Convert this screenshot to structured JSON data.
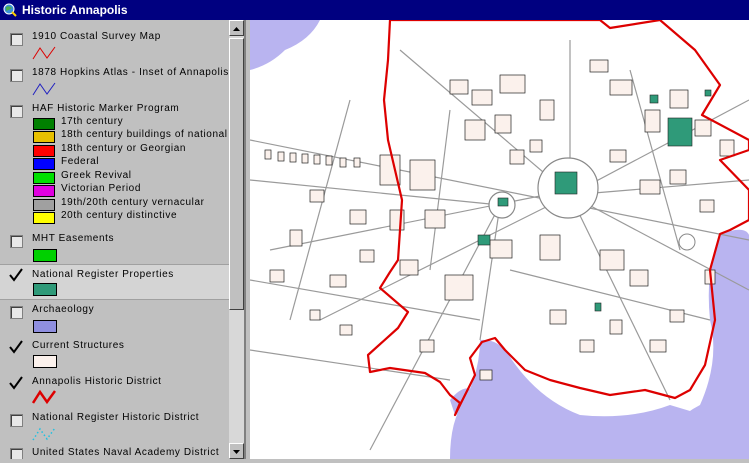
{
  "window": {
    "title": "Historic Annapolis"
  },
  "colors": {
    "titlebar": "#000080",
    "water": "#b9b4f0",
    "district": "#dd0000",
    "building_green": "#2f9a79"
  },
  "layers": [
    {
      "label": "1910 Coastal Survey Map",
      "checked": false,
      "symbol": "red-line"
    },
    {
      "label": "1878 Hopkins Atlas - Inset of Annapolis",
      "checked": false,
      "symbol": "blue-line"
    },
    {
      "label": "HAF Historic Marker Program",
      "checked": false,
      "symbol": "categories",
      "categories": [
        {
          "label": "17th century",
          "color": "#008000"
        },
        {
          "label": "18th century buildings of national",
          "color": "#e8c000"
        },
        {
          "label": "18th century or Georgian",
          "color": "#ff0000"
        },
        {
          "label": "Federal",
          "color": "#0000ff"
        },
        {
          "label": "Greek Revival",
          "color": "#00e000"
        },
        {
          "label": "Victorian Period",
          "color": "#e000e0"
        },
        {
          "label": "19th/20th century vernacular",
          "color": "#a0a0a0"
        },
        {
          "label": "20th century distinctive",
          "color": "#ffff00"
        }
      ]
    },
    {
      "label": "MHT Easements",
      "checked": false,
      "symbol": "swatch",
      "color": "#00d000"
    },
    {
      "label": "National Register Properties",
      "checked": true,
      "symbol": "swatch",
      "color": "#2f9a79"
    },
    {
      "label": "Archaeology",
      "checked": false,
      "symbol": "swatch",
      "color": "#8f8fe0"
    },
    {
      "label": "Current Structures",
      "checked": true,
      "symbol": "swatch",
      "color": "#fbf1ec"
    },
    {
      "label": "Annapolis Historic District",
      "checked": true,
      "symbol": "red-line"
    },
    {
      "label": "National Register Historic District",
      "checked": false,
      "symbol": "cyan-dotted"
    },
    {
      "label": "United States Naval Academy District",
      "checked": false,
      "symbol": "none"
    }
  ]
}
